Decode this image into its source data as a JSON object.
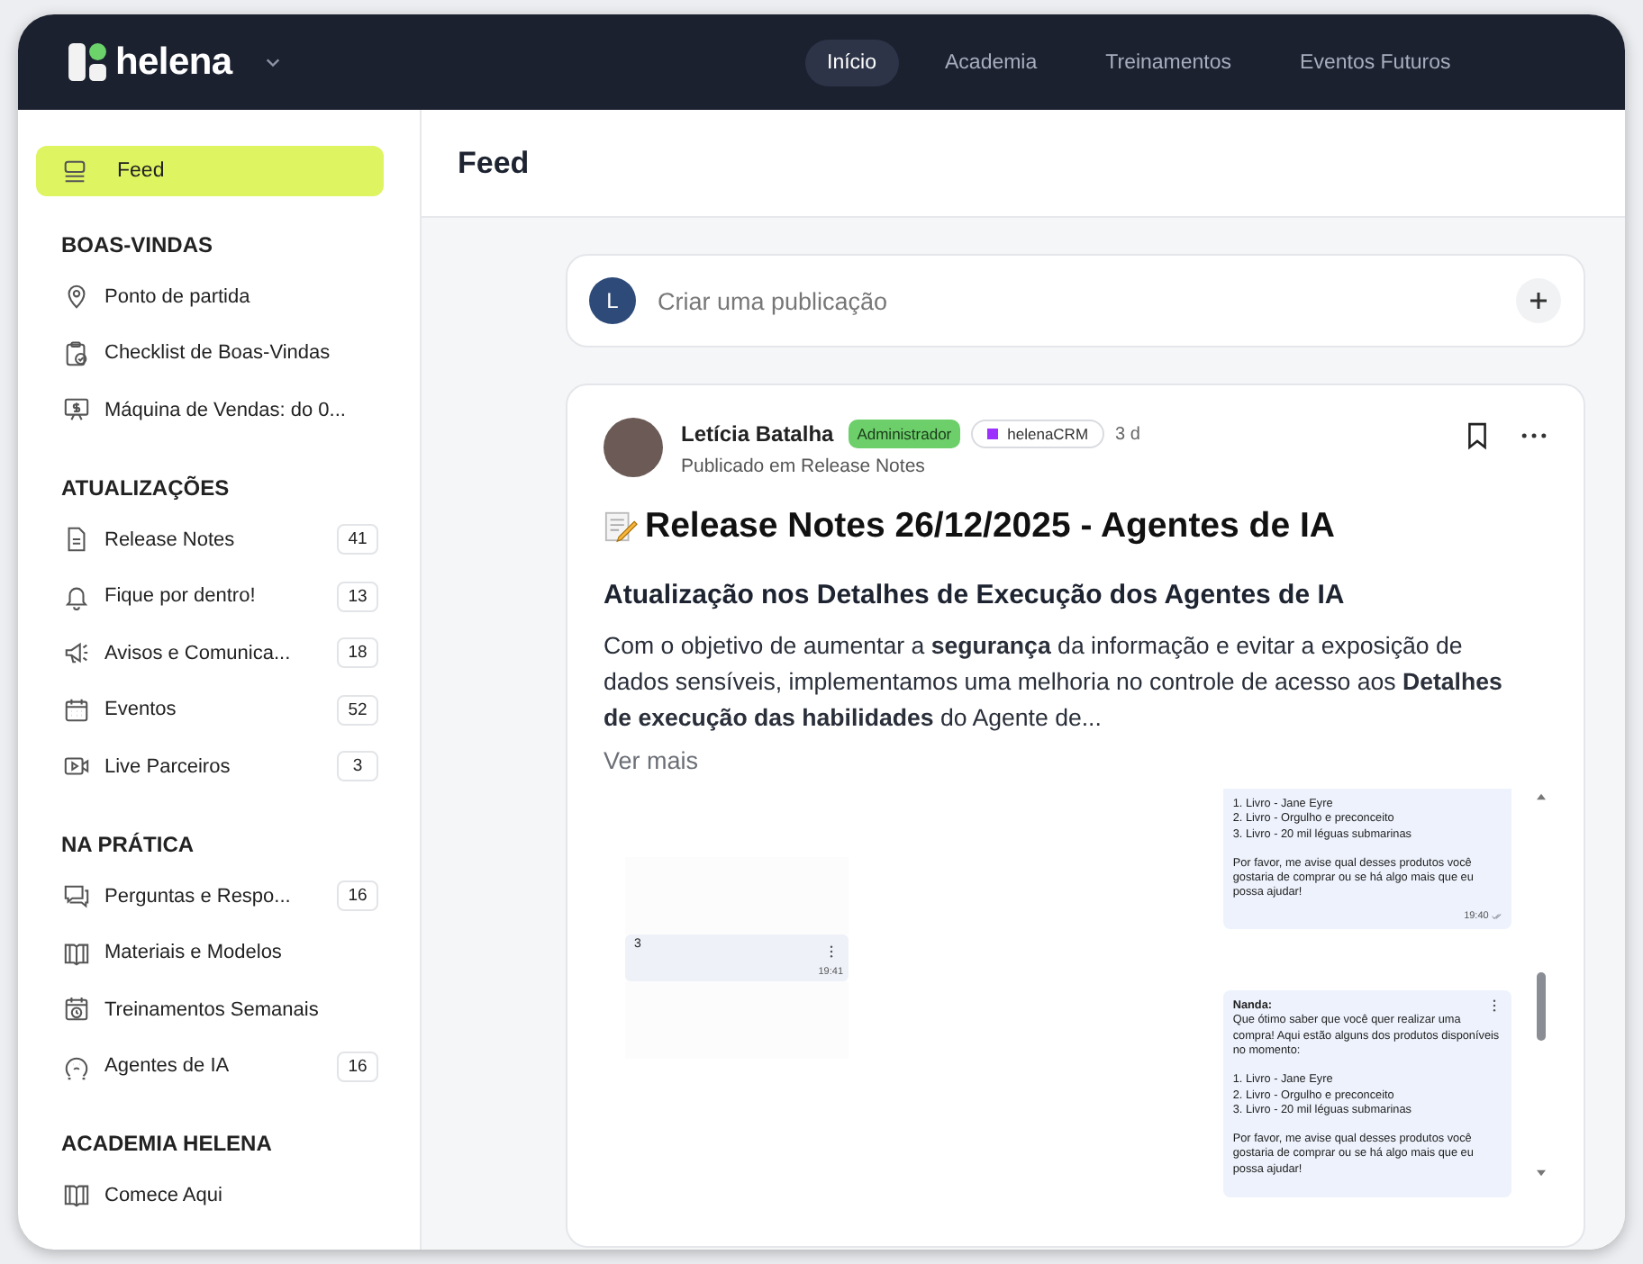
{
  "brand": {
    "name": "helena"
  },
  "nav": [
    {
      "label": "Início",
      "selected": true
    },
    {
      "label": "Academia",
      "selected": false
    },
    {
      "label": "Treinamentos",
      "selected": false
    },
    {
      "label": "Eventos Futuros",
      "selected": false
    }
  ],
  "sidebar": {
    "top_item": {
      "label": "Feed",
      "selected": true
    },
    "sections": [
      {
        "title": "BOAS-VINDAS",
        "items": [
          {
            "label": "Ponto de partida",
            "selected": false
          },
          {
            "label": "Checklist de Boas-Vindas",
            "selected": false
          },
          {
            "label": "Máquina de Vendas: do 0...",
            "selected": false
          }
        ]
      },
      {
        "title": "ATUALIZAÇÕES",
        "items": [
          {
            "label": "Release Notes",
            "count": "41",
            "selected": false
          },
          {
            "label": "Fique por dentro!",
            "count": "13",
            "selected": false
          },
          {
            "label": "Avisos e Comunica...",
            "count": "18",
            "selected": false
          },
          {
            "label": "Eventos",
            "count": "52",
            "selected": false
          },
          {
            "label": "Live Parceiros",
            "count": "3",
            "selected": false
          }
        ]
      },
      {
        "title": "NA PRÁTICA",
        "items": [
          {
            "label": "Perguntas e Respo...",
            "count": "16",
            "selected": false
          },
          {
            "label": "Materiais e Modelos",
            "selected": false
          },
          {
            "label": "Treinamentos Semanais",
            "selected": false
          },
          {
            "label": "Agentes de IA",
            "count": "16",
            "selected": false
          }
        ]
      },
      {
        "title": "ACADEMIA HELENA",
        "items": [
          {
            "label": "Comece Aqui",
            "selected": false
          }
        ]
      }
    ]
  },
  "page_title": "Feed",
  "composer": {
    "avatar_letter": "L",
    "placeholder": "Criar uma publicação"
  },
  "post": {
    "author": "Letícia Batalha",
    "role_badge": "Administrador",
    "tag": "helenaCRM",
    "age": "3 d",
    "published_in": "Publicado em Release Notes",
    "title": "Release Notes 26/12/2025 - Agentes de IA",
    "subtitle": "Atualização nos Detalhes de Execução dos Agentes de IA",
    "body": "Com o objetivo de aumentar a **segurança** da informação e evitar a exposição de dados sensíveis, implementamos uma melhoria no controle de acesso aos **Detalhes de execução das habilidades** do Agente de...",
    "more_link": "Ver mais",
    "embedded_chat": {
      "left_bubble": {
        "text": "3",
        "time": "19:41"
      },
      "right_bubbles": [
        {
          "paragraphs": [
            [
              "1. Livro - Jane Eyre",
              "2. Livro - Orgulho e preconceito",
              "3. Livro - 20 mil léguas submarinas"
            ],
            [
              "Por favor, me avise qual desses produtos você gostaria de comprar ou se há algo mais que eu possa ajudar!"
            ]
          ],
          "time": "19:40"
        },
        {
          "sender": "Nanda:",
          "paragraphs": [
            [
              "Que ótimo saber que você quer realizar uma compra! Aqui estão alguns dos produtos disponíveis no momento:"
            ],
            [
              "1. Livro - Jane Eyre",
              "2. Livro - Orgulho e preconceito",
              "3. Livro - 20 mil léguas submarinas"
            ],
            [
              "Por favor, me avise qual desses produtos você gostaria de comprar ou se há algo mais que eu possa ajudar!"
            ]
          ]
        }
      ]
    }
  }
}
